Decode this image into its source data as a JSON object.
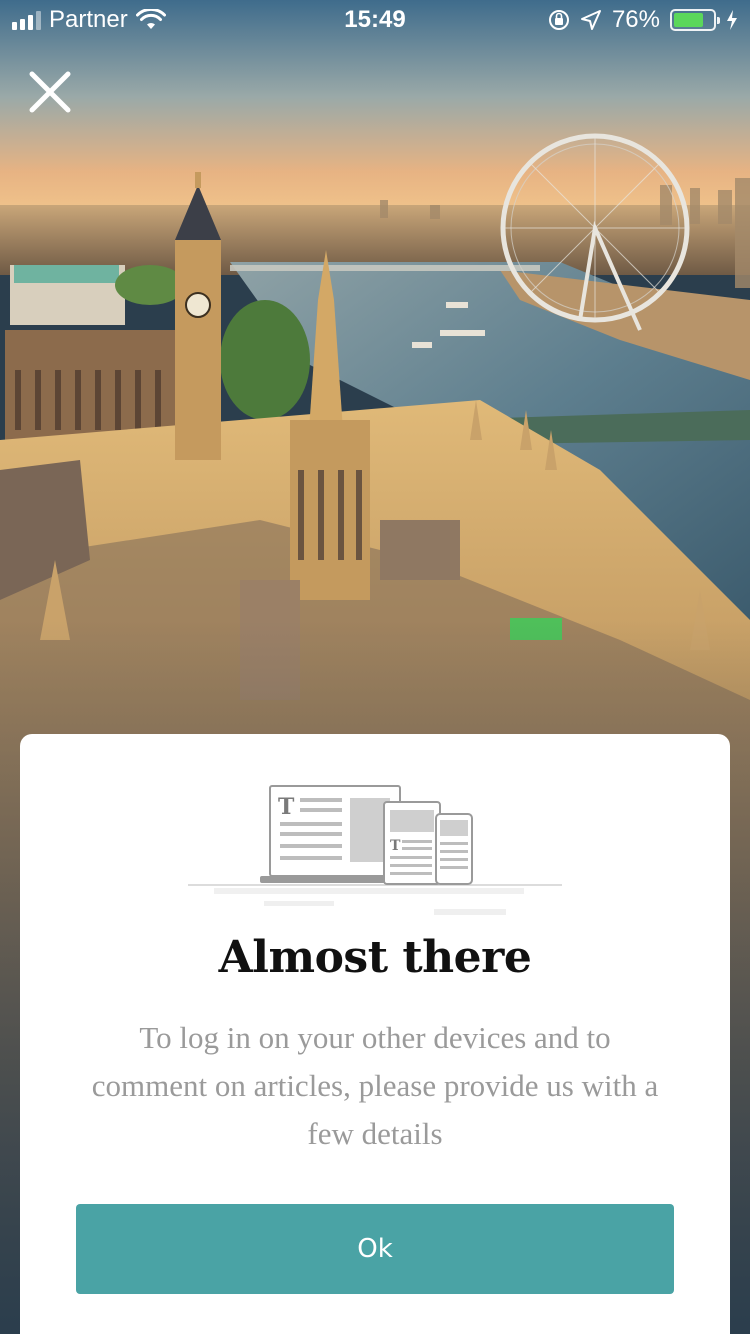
{
  "status_bar": {
    "carrier": "Partner",
    "time": "15:49",
    "battery_percent": "76%",
    "battery_level": 0.76,
    "battery_color": "#5bd75b",
    "icons": [
      "signal-icon",
      "wifi-icon",
      "orientation-lock-icon",
      "location-icon",
      "battery-icon",
      "charging-icon"
    ]
  },
  "close": {
    "icon": "close-icon"
  },
  "card": {
    "illustration": "devices-illustration",
    "title": "Almost there",
    "body": "To log in on your other devices and to comment on articles, please provide us with a few details",
    "ok_label": "Ok",
    "accent_color": "#4aa3a5"
  }
}
